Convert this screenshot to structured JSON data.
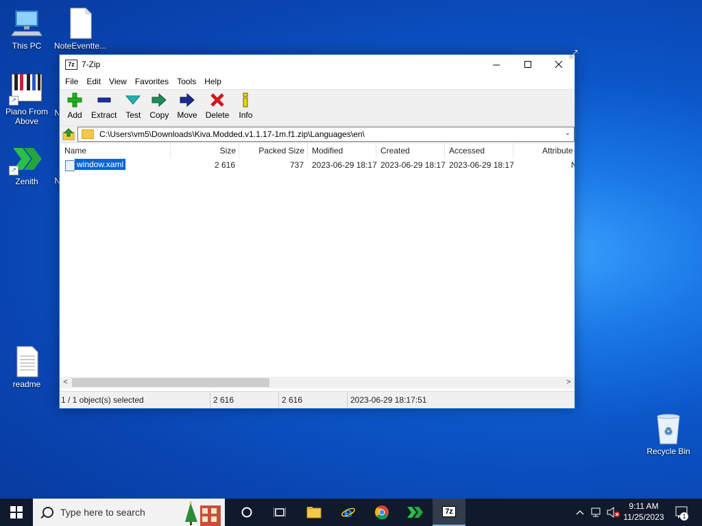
{
  "desktop": {
    "icons": [
      {
        "label": "This PC"
      },
      {
        "label": "NoteEventte..."
      },
      {
        "label": "Piano From Above"
      },
      {
        "label": "N"
      },
      {
        "label": "Zenith"
      },
      {
        "label": "N"
      },
      {
        "label": "readme"
      },
      {
        "label": "Recycle Bin"
      }
    ]
  },
  "window": {
    "title": "7-Zip",
    "app_icon_text": "7z",
    "menu": [
      "File",
      "Edit",
      "View",
      "Favorites",
      "Tools",
      "Help"
    ],
    "toolbar": [
      {
        "label": "Add",
        "icon": "plus-icon",
        "color": "#1db31d"
      },
      {
        "label": "Extract",
        "icon": "minus-icon",
        "color": "#1c2ea8"
      },
      {
        "label": "Test",
        "icon": "check-arrow-icon",
        "color": "#22b2b2"
      },
      {
        "label": "Copy",
        "icon": "copy-arrow-icon",
        "color": "#1f8a5a"
      },
      {
        "label": "Move",
        "icon": "move-arrow-icon",
        "color": "#1b2b8f"
      },
      {
        "label": "Delete",
        "icon": "x-icon",
        "color": "#d11a1a"
      },
      {
        "label": "Info",
        "icon": "info-icon",
        "color": "#c7b800"
      }
    ],
    "address": "C:\\Users\\vm5\\Downloads\\Kiva.Modded.v1.1.17-1m.f1.zip\\Languages\\en\\",
    "columns": [
      "Name",
      "Size",
      "Packed Size",
      "Modified",
      "Created",
      "Accessed",
      "Attribute"
    ],
    "rows": [
      {
        "name": "window.xaml",
        "size": "2 616",
        "packed_size": "737",
        "modified": "2023-06-29 18:17",
        "created": "2023-06-29 18:17",
        "accessed": "2023-06-29 18:17",
        "attributes": "N"
      }
    ],
    "status": {
      "selection": "1 / 1 object(s) selected",
      "size": "2 616",
      "packed": "2 616",
      "date": "2023-06-29 18:17:51"
    }
  },
  "taskbar": {
    "search_placeholder": "Type here to search",
    "time": "9:11 AM",
    "date": "11/25/2023",
    "notification_count": "1"
  },
  "colors": {
    "selection": "#0a64d6",
    "taskbar": "#101a2b",
    "window_border": "#1f73c9"
  }
}
